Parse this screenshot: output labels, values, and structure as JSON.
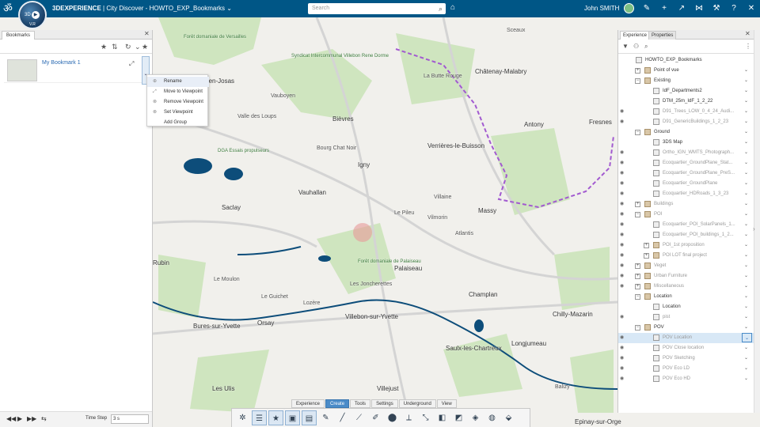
{
  "app": {
    "brand": "3DEXPERIENCE",
    "title_separator": "|",
    "title": "City Discover - HOWTO_EXP_Bookmarks",
    "compass_version": "V.R"
  },
  "topbar": {
    "search_placeholder": "Search",
    "user_name": "John SMITH"
  },
  "left_panel": {
    "tab_label": "Bookmarks",
    "bookmark": {
      "name": "My Bookmark 1"
    },
    "context_menu": [
      "Rename",
      "Move to Viewpoint",
      "Remove Viewpoint",
      "Set Viewpoint",
      "Add Group"
    ],
    "time_step_label": "Time Step",
    "time_step_value": "3 s"
  },
  "right_panel": {
    "tabs": [
      "Experience",
      "Properties"
    ],
    "tree": [
      {
        "label": "HOWTO_EXP_Bookmarks",
        "level": 0,
        "folder": false,
        "dim": false,
        "eye": false
      },
      {
        "label": "Point of vue",
        "level": 1,
        "folder": true,
        "dim": false,
        "eye": false,
        "tog": "+"
      },
      {
        "label": "Existing",
        "level": 1,
        "folder": true,
        "dim": false,
        "eye": false,
        "tog": "−"
      },
      {
        "label": "IdF_Departments2",
        "level": 2,
        "folder": false,
        "dim": false,
        "eye": false
      },
      {
        "label": "DTM_25m_IdF_1_2_22",
        "level": 2,
        "folder": false,
        "dim": false,
        "eye": false
      },
      {
        "label": "D91_Trees_LOW_0_4_24_Audi...",
        "level": 2,
        "folder": false,
        "dim": true,
        "eye": true
      },
      {
        "label": "D91_GenericBuildings_1_2_23",
        "level": 2,
        "folder": false,
        "dim": true,
        "eye": true
      },
      {
        "label": "Ground",
        "level": 1,
        "folder": true,
        "dim": false,
        "eye": false,
        "tog": "−"
      },
      {
        "label": "3DS Map",
        "level": 2,
        "folder": false,
        "dim": false,
        "eye": false
      },
      {
        "label": "Ortho_IGN_WMTS_Photograph...",
        "level": 2,
        "folder": false,
        "dim": true,
        "eye": true
      },
      {
        "label": "Ecoquartier_GroundPlane_Stat...",
        "level": 2,
        "folder": false,
        "dim": true,
        "eye": true
      },
      {
        "label": "Ecoquartier_GroundPlane_PreS...",
        "level": 2,
        "folder": false,
        "dim": true,
        "eye": true
      },
      {
        "label": "Ecoquartier_GroundPlane",
        "level": 2,
        "folder": false,
        "dim": true,
        "eye": true
      },
      {
        "label": "Ecoquartier_HDRoads_1_3_23",
        "level": 2,
        "folder": false,
        "dim": true,
        "eye": true
      },
      {
        "label": "Buildings",
        "level": 1,
        "folder": true,
        "dim": true,
        "eye": true,
        "tog": "+"
      },
      {
        "label": "POI",
        "level": 1,
        "folder": true,
        "dim": true,
        "eye": true,
        "tog": "−"
      },
      {
        "label": "Ecoquartier_POI_SolarPanels_1...",
        "level": 2,
        "folder": false,
        "dim": true,
        "eye": true
      },
      {
        "label": "Ecoquartier_POI_buildings_1_2...",
        "level": 2,
        "folder": false,
        "dim": true,
        "eye": true
      },
      {
        "label": "POI_1st proposition",
        "level": 2,
        "folder": true,
        "dim": true,
        "eye": true,
        "tog": "+"
      },
      {
        "label": "POI LOT final project",
        "level": 2,
        "folder": true,
        "dim": true,
        "eye": true,
        "tog": "+"
      },
      {
        "label": "Veget",
        "level": 1,
        "folder": true,
        "dim": true,
        "eye": true,
        "tog": "+"
      },
      {
        "label": "Urban Furniture",
        "level": 1,
        "folder": true,
        "dim": true,
        "eye": true,
        "tog": "+"
      },
      {
        "label": "Miscellaneous",
        "level": 1,
        "folder": true,
        "dim": true,
        "eye": true,
        "tog": "+"
      },
      {
        "label": "Location",
        "level": 1,
        "folder": true,
        "dim": false,
        "eye": false,
        "tog": "−"
      },
      {
        "label": "Location",
        "level": 2,
        "folder": false,
        "dim": false,
        "eye": false
      },
      {
        "label": "pist",
        "level": 2,
        "folder": false,
        "dim": true,
        "eye": true
      },
      {
        "label": "POV",
        "level": 1,
        "folder": true,
        "dim": false,
        "eye": false,
        "tog": "−"
      },
      {
        "label": "POV Location",
        "level": 2,
        "folder": false,
        "dim": true,
        "eye": true,
        "selected": true
      },
      {
        "label": "POV Close location",
        "level": 2,
        "folder": false,
        "dim": true,
        "eye": true
      },
      {
        "label": "POV Sketching",
        "level": 2,
        "folder": false,
        "dim": true,
        "eye": true
      },
      {
        "label": "POV Eco LD",
        "level": 2,
        "folder": false,
        "dim": true,
        "eye": true
      },
      {
        "label": "POV Eco HD",
        "level": 2,
        "folder": false,
        "dim": true,
        "eye": true
      }
    ]
  },
  "action_bar": {
    "tabs": [
      "Experience",
      "Create",
      "Tools",
      "Settings",
      "Underground",
      "View"
    ],
    "active_tab": "Create",
    "tools": [
      "compass-tool-icon",
      "bookmark-list-icon",
      "add-bookmark-icon",
      "image-bookmark-icon",
      "table-icon",
      "pen-icon",
      "line-icon",
      "polyline-icon",
      "brush-icon",
      "marker-icon",
      "measure-icon",
      "dimension-icon",
      "cube-icon",
      "box-edit-icon",
      "layers-icon",
      "sphere-icon",
      "paint-bucket-icon"
    ]
  },
  "map": {
    "labels": [
      "Forêt domaniale de Versailles",
      "Jouy-en-Josas",
      "Vauboyen",
      "Bièvres",
      "Châtenay-Malabry",
      "Antony",
      "Fresnes",
      "Verrières-le-Buisson",
      "Igny",
      "Bourg Chat Noir",
      "Vauhallan",
      "Saclay",
      "Massy",
      "Palaiseau",
      "Forêt domaniale de Palaiseau",
      "Rubin",
      "Le Moulon",
      "Orsay",
      "Bures-sur-Yvette",
      "Villebon-sur-Yvette",
      "Champlan",
      "Chilly-Mazarin",
      "Saulx-les-Chartreux",
      "Longjumeau",
      "Les Ulis",
      "Villejust",
      "Epinay-sur-Orge",
      "Valle des Loups",
      "Le Pileu",
      "Vilmorin",
      "Atlantis",
      "Lozère",
      "Le Guichet",
      "Les Joncherettes",
      "La Butte Rouge",
      "Sceaux",
      "Balizy",
      "Villaine",
      "DGA Essais propulseurs",
      "Syndicat Intercommunal Villebon Rene Dorme"
    ]
  },
  "colors": {
    "topbar": "#005686",
    "accent": "#4a8bc8",
    "map_green": "#c9e2b8",
    "water": "#0d4d7a",
    "boundary": "#a25ad0"
  }
}
